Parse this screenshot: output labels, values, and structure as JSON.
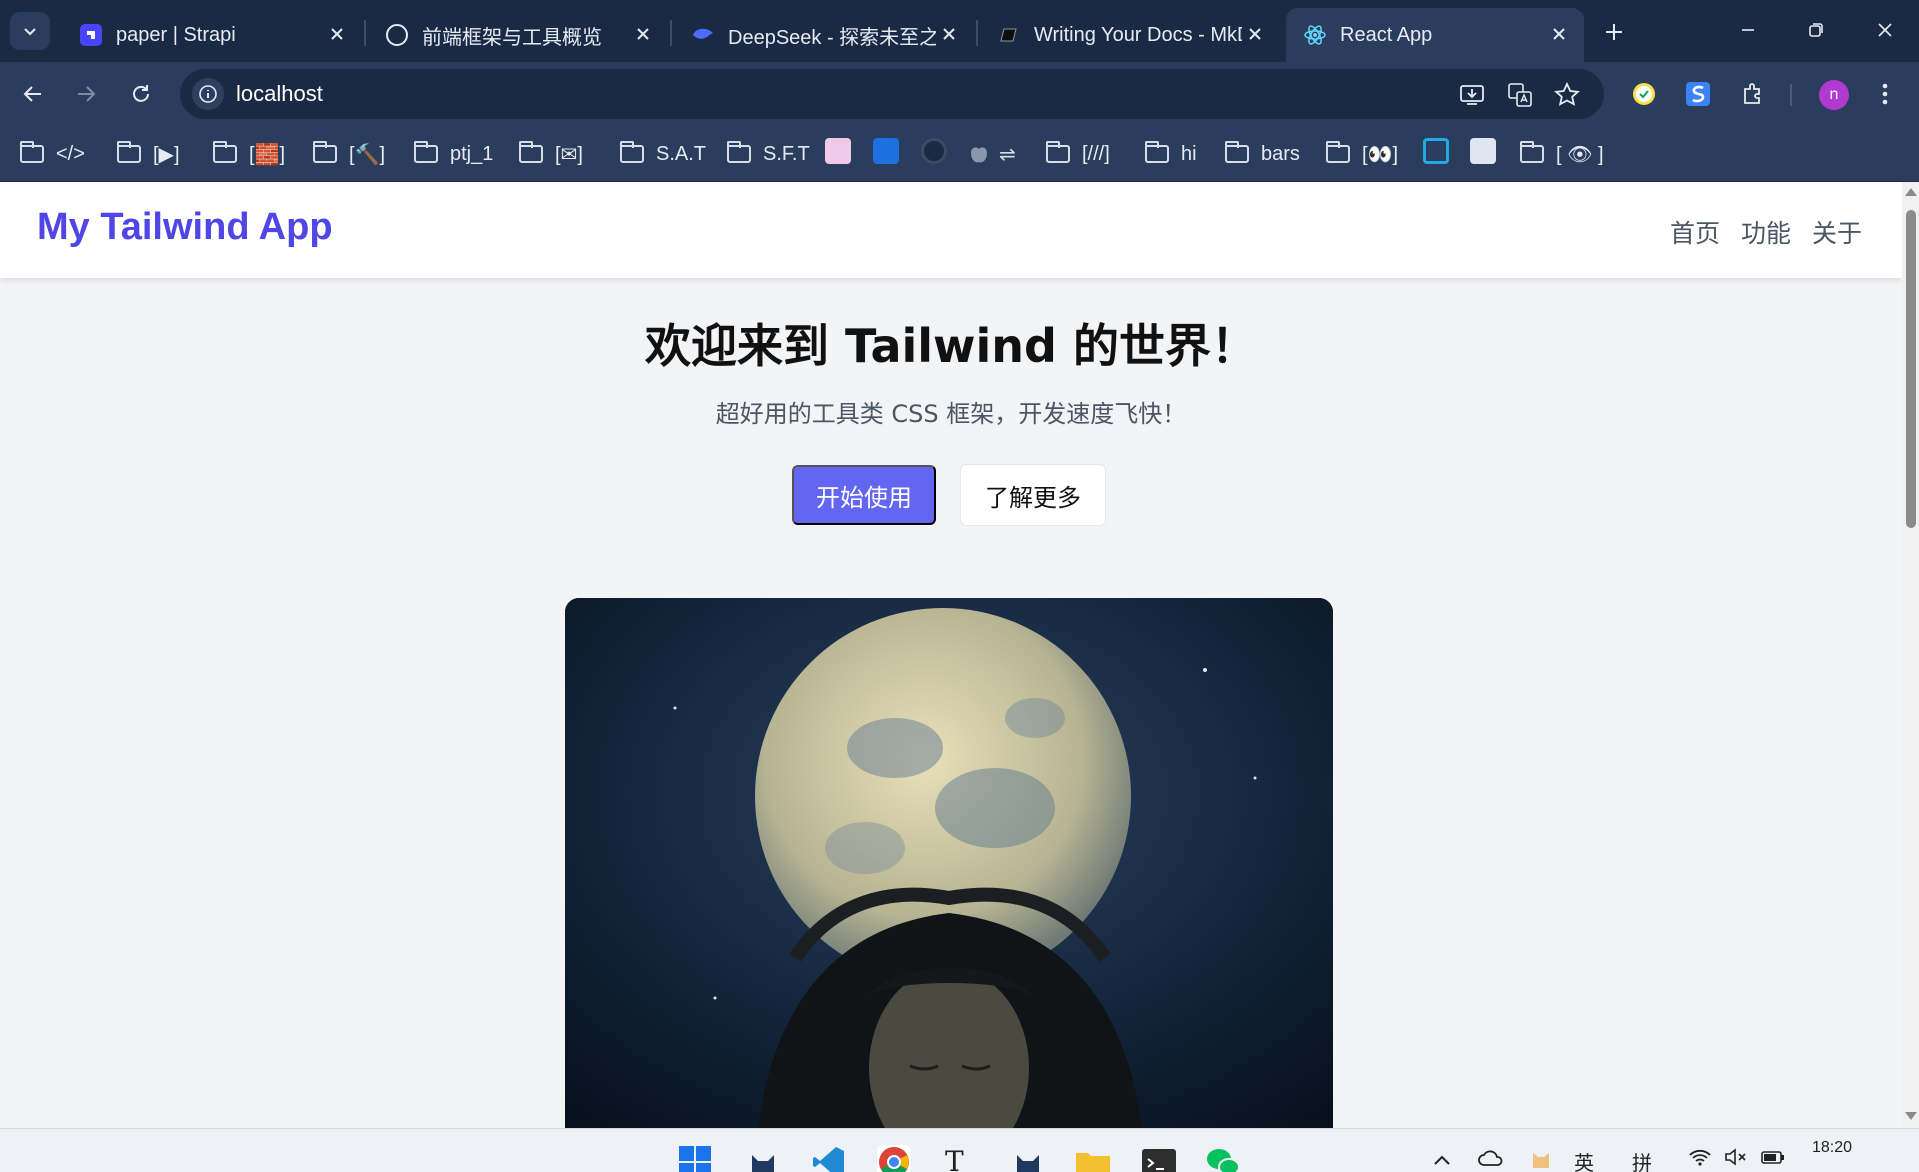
{
  "browser": {
    "tabs": [
      {
        "title": "paper | Strapi",
        "active": false
      },
      {
        "title": "前端框架与工具概览",
        "active": false
      },
      {
        "title": "DeepSeek - 探索未至之境",
        "active": false
      },
      {
        "title": "Writing Your Docs - MkDocs",
        "active": false
      },
      {
        "title": "React App",
        "active": true
      }
    ],
    "address": "localhost",
    "bookmarks": [
      "</>",
      "[▶]",
      "[🧱]",
      "[🔨]",
      "ptj_1",
      "[✉]",
      "S.A.T",
      "S.F.T",
      "[///]",
      "hi",
      "bars",
      "[👀]",
      "[ 👁 ]"
    ],
    "profile_initial": "n"
  },
  "app": {
    "brand": "My Tailwind App",
    "nav": [
      "首页",
      "功能",
      "关于"
    ],
    "hero_title": "欢迎来到 Tailwind 的世界！",
    "hero_subtitle": "超好用的工具类 CSS 框架，开发速度飞快！",
    "primary_button": "开始使用",
    "secondary_button": "了解更多"
  },
  "taskbar": {
    "ime_lang": "英",
    "ime_mode": "拼",
    "time": "18:20"
  },
  "colors": {
    "brand": "#4f46e5",
    "primary": "#6366f1",
    "chrome_dark": "#1b2a44",
    "chrome": "#2b3d5c"
  }
}
